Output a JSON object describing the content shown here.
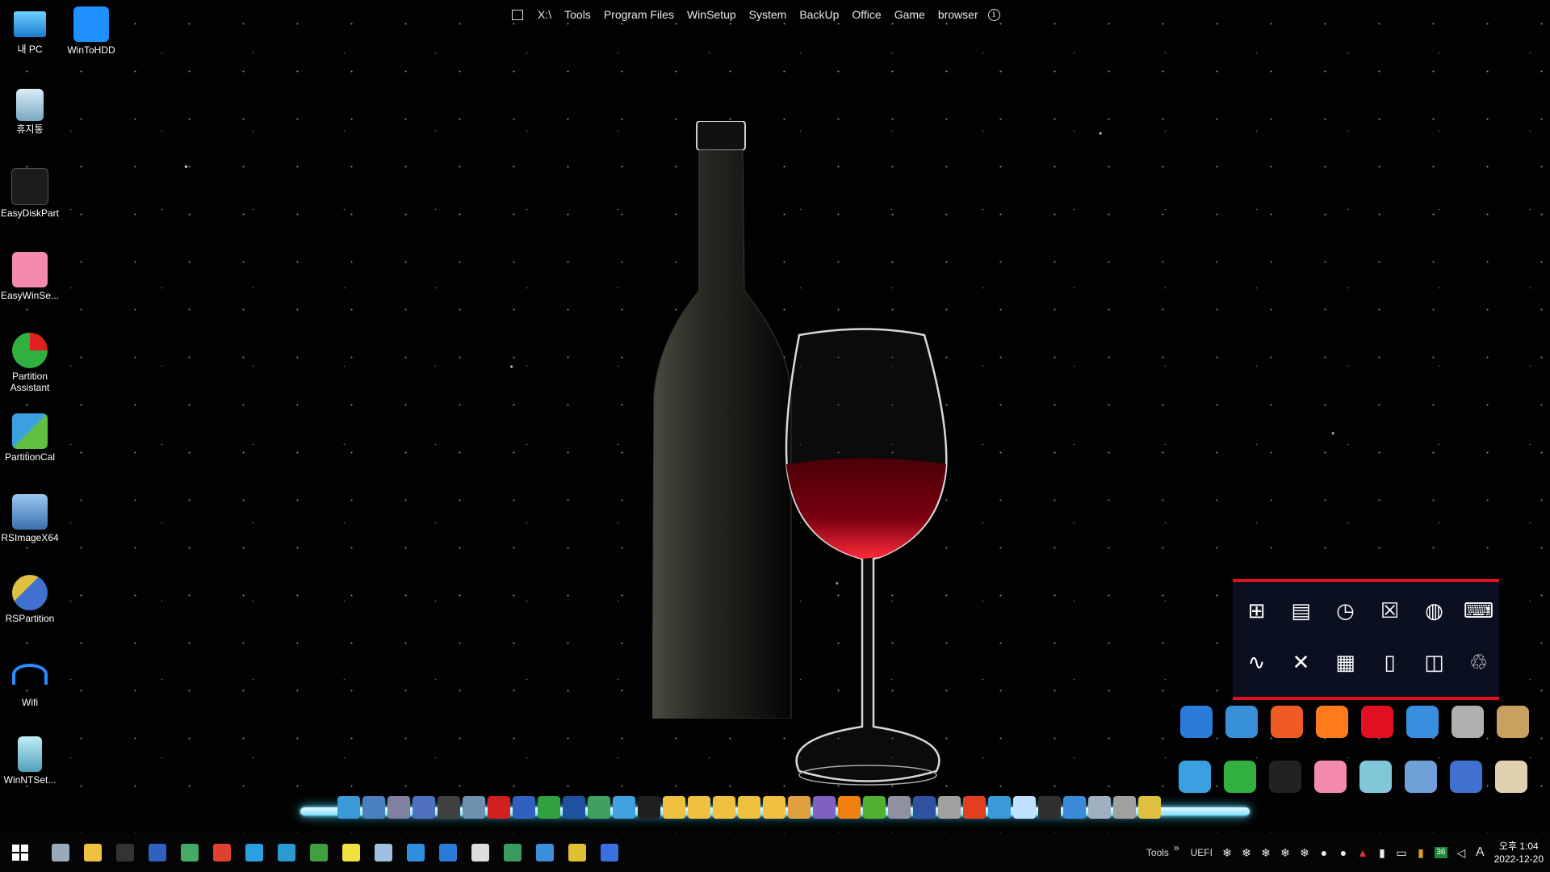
{
  "top_menu": {
    "items": [
      "X:\\",
      "Tools",
      "Program Files",
      "WinSetup",
      "System",
      "BackUp",
      "Office",
      "Game",
      "browser"
    ]
  },
  "desktop_icons": [
    {
      "label": "내 PC",
      "icon": "computer-icon",
      "color": "#3aa8e8"
    },
    {
      "label": "WinToHDD",
      "icon": "windows-icon",
      "color": "#1e90ff"
    },
    {
      "label": "휴지통",
      "icon": "recycle-bin-icon",
      "color": "#a8c8d8"
    },
    {
      "label": "EasyDiskPart",
      "icon": "disk-icon",
      "color": "#222222"
    },
    {
      "label": "EasyWinSe...",
      "icon": "windows-pink-icon",
      "color": "#f48ab0"
    },
    {
      "label": "Partition Assistant",
      "icon": "pie-chart-icon",
      "color": "#30b040"
    },
    {
      "label": "PartitionCal",
      "icon": "puzzle-icon",
      "color": "#3aa0e0"
    },
    {
      "label": "RSImageX64",
      "icon": "monitor-gear-icon",
      "color": "#6fa0d8"
    },
    {
      "label": "RSPartition",
      "icon": "partition-tool-icon",
      "color": "#4070d0"
    },
    {
      "label": "Wifi",
      "icon": "wifi-icon",
      "color": "#2a8cff"
    },
    {
      "label": "WinNTSet...",
      "icon": "setup-icon",
      "color": "#80c8d8"
    }
  ],
  "launcher": {
    "row1": [
      {
        "icon": "windows-logo-icon",
        "glyph": "⊞"
      },
      {
        "icon": "notepad-icon",
        "glyph": "▤"
      },
      {
        "icon": "clock-icon",
        "glyph": "◷"
      },
      {
        "icon": "close-box-icon",
        "glyph": "☒"
      },
      {
        "icon": "globe-icon",
        "glyph": "◍"
      },
      {
        "icon": "terminal-icon",
        "glyph": "⌨"
      }
    ],
    "row2": [
      {
        "icon": "pulse-icon",
        "glyph": "∿"
      },
      {
        "icon": "tools-icon",
        "glyph": "✕"
      },
      {
        "icon": "calculator-icon",
        "glyph": "▦"
      },
      {
        "icon": "mouse-icon",
        "glyph": "▯"
      },
      {
        "icon": "window-edit-icon",
        "glyph": "◫"
      },
      {
        "icon": "recycle-icon",
        "glyph": "♲"
      }
    ]
  },
  "right_apps_row1": [
    {
      "icon": "photo-viewer-icon",
      "color": "#2b7bd8"
    },
    {
      "icon": "folder-blue-icon",
      "color": "#3a90d8"
    },
    {
      "icon": "brave-browser-icon",
      "color": "#f05a24"
    },
    {
      "icon": "firefox-icon",
      "color": "#ff7a1a"
    },
    {
      "icon": "opera-icon",
      "color": "#e01020"
    },
    {
      "icon": "sync-icon",
      "color": "#3a8ee0"
    },
    {
      "icon": "disk-tool-icon",
      "color": "#b0b0b0"
    },
    {
      "icon": "disc-icon",
      "color": "#c8a060"
    }
  ],
  "right_apps_row2": [
    {
      "icon": "puzzle-icon",
      "color": "#3aa0e0"
    },
    {
      "icon": "pie-chart-icon",
      "color": "#30b040"
    },
    {
      "icon": "easydiskpart-icon",
      "color": "#222222"
    },
    {
      "icon": "windows-pink-icon",
      "color": "#f48ab0"
    },
    {
      "icon": "setup-icon",
      "color": "#80c8d8"
    },
    {
      "icon": "monitor-gear-icon",
      "color": "#6fa0d8"
    },
    {
      "icon": "partition-tool-icon",
      "color": "#4070d0"
    },
    {
      "icon": "document-icon",
      "color": "#e0d0b0"
    }
  ],
  "dock_icons": [
    {
      "icon": "monitor-icon",
      "color": "#3a9ad8"
    },
    {
      "icon": "network-icon",
      "color": "#4a80c0"
    },
    {
      "icon": "search-icon",
      "color": "#8080a0"
    },
    {
      "icon": "qr-icon",
      "color": "#5070c0"
    },
    {
      "icon": "user-add-icon",
      "color": "#404040"
    },
    {
      "icon": "settings-icon",
      "color": "#7090b0"
    },
    {
      "icon": "pixel-app-icon",
      "color": "#d02020"
    },
    {
      "icon": "save-icon",
      "color": "#3060c0"
    },
    {
      "icon": "chart-icon",
      "color": "#30a040"
    },
    {
      "icon": "screen-icon",
      "color": "#2050a0"
    },
    {
      "icon": "image-icon",
      "color": "#40a060"
    },
    {
      "icon": "cubes-icon",
      "color": "#40a0e0"
    },
    {
      "icon": "shield-icon",
      "color": "#202020"
    },
    {
      "icon": "folder-icon",
      "color": "#f0c040"
    },
    {
      "icon": "folder-icon",
      "color": "#f0c040"
    },
    {
      "icon": "folder-icon",
      "color": "#f0c040"
    },
    {
      "icon": "folder-icon",
      "color": "#f0c040"
    },
    {
      "icon": "folder-icon",
      "color": "#f0c040"
    },
    {
      "icon": "paint-icon",
      "color": "#e0a040"
    },
    {
      "icon": "phone-icon",
      "color": "#8060c0"
    },
    {
      "icon": "vlc-icon",
      "color": "#f08010"
    },
    {
      "icon": "utorrent-icon",
      "color": "#50b030"
    },
    {
      "icon": "printer-icon",
      "color": "#9090a0"
    },
    {
      "icon": "computer-icon",
      "color": "#3050a0"
    },
    {
      "icon": "disc-icon",
      "color": "#a0a0a0"
    },
    {
      "icon": "x-icon",
      "color": "#e04020"
    },
    {
      "icon": "display-icon",
      "color": "#3a9ad8"
    },
    {
      "icon": "snowflake-icon",
      "color": "#c0e0ff"
    },
    {
      "icon": "cmd-icon",
      "color": "#303030"
    },
    {
      "icon": "tiles-icon",
      "color": "#3a8ad8"
    },
    {
      "icon": "trash-icon",
      "color": "#a0b0c0"
    },
    {
      "icon": "tools-icon",
      "color": "#a0a0a0"
    },
    {
      "icon": "wand-icon",
      "color": "#e0c040"
    }
  ],
  "taskbar_apps": [
    {
      "icon": "search-icon",
      "color": "#9ab"
    },
    {
      "icon": "file-explorer-icon",
      "color": "#f0c040"
    },
    {
      "icon": "cmd-icon",
      "color": "#333"
    },
    {
      "icon": "save-icon",
      "color": "#3060c0"
    },
    {
      "icon": "keyboard-icon",
      "color": "#4a6"
    },
    {
      "icon": "chrome-icon",
      "color": "#e04030"
    },
    {
      "icon": "edge-icon",
      "color": "#2aa0e0"
    },
    {
      "icon": "monitor-icon",
      "color": "#2a9ad0"
    },
    {
      "icon": "install-icon",
      "color": "#40a040"
    },
    {
      "icon": "sticky-note-icon",
      "color": "#f0e040"
    },
    {
      "icon": "pen-icon",
      "color": "#a0c0e0"
    },
    {
      "icon": "mail-icon",
      "color": "#3090e0"
    },
    {
      "icon": "photo-viewer-icon",
      "color": "#2b7bd8"
    },
    {
      "icon": "drop-icon",
      "color": "#ddd"
    },
    {
      "icon": "network-globe-icon",
      "color": "#3a9a60"
    },
    {
      "icon": "folder-blue-icon",
      "color": "#3a90d8"
    },
    {
      "icon": "archive-icon",
      "color": "#e0c030"
    },
    {
      "icon": "power-icon",
      "color": "#3a70e0"
    }
  ],
  "tray": {
    "tools_label": "Tools",
    "chevron": "»",
    "uefi_label": "UEFI",
    "badge": "36",
    "ime_label": "A",
    "time": "오후 1:04",
    "date": "2022-12-20"
  }
}
